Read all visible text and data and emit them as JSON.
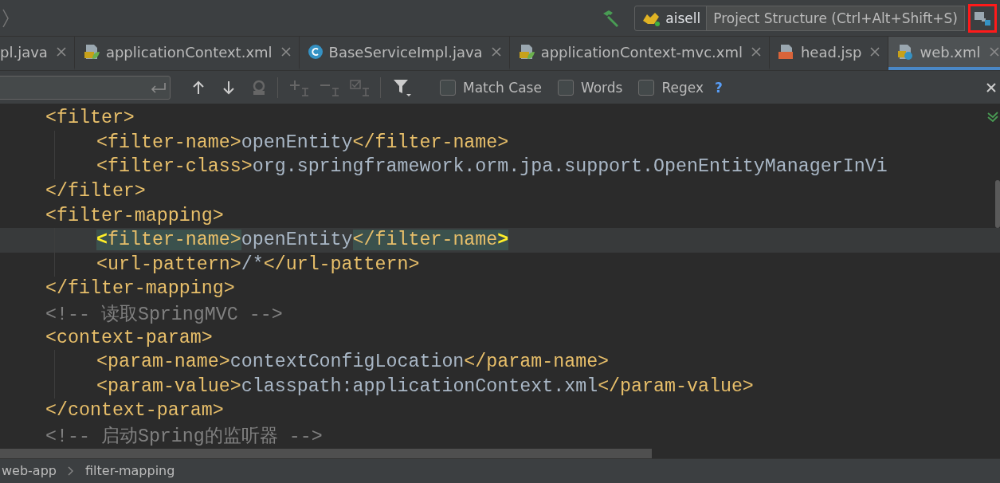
{
  "toolbar": {
    "run_config": "aisell",
    "tooltip": "Project Structure (Ctrl+Alt+Shift+S)"
  },
  "tabs": [
    {
      "label": "pl.java",
      "kind": "java",
      "selected": false
    },
    {
      "label": "applicationContext.xml",
      "kind": "spring",
      "selected": false
    },
    {
      "label": "BaseServiceImpl.java",
      "kind": "class",
      "selected": false
    },
    {
      "label": "applicationContext-mvc.xml",
      "kind": "spring",
      "selected": false
    },
    {
      "label": "head.jsp",
      "kind": "jsp",
      "selected": false
    },
    {
      "label": "web.xml",
      "kind": "web",
      "selected": true
    }
  ],
  "find_bar": {
    "options": [
      {
        "label": "Match Case",
        "checked": false
      },
      {
        "label": "Words",
        "checked": false
      },
      {
        "label": "Regex",
        "checked": false
      }
    ],
    "help": "?"
  },
  "code_lines": [
    {
      "indented": false,
      "current": false,
      "segments": [
        {
          "kind": "tag",
          "text": "<filter>"
        }
      ]
    },
    {
      "indented": true,
      "current": false,
      "segments": [
        {
          "kind": "tag",
          "text": "<filter-name>"
        },
        {
          "kind": "text",
          "text": "openEntity"
        },
        {
          "kind": "tag",
          "text": "</filter-name>"
        }
      ]
    },
    {
      "indented": true,
      "current": false,
      "segments": [
        {
          "kind": "tag",
          "text": "<filter-class>"
        },
        {
          "kind": "text",
          "text": "org.springframework.orm.jpa.support.OpenEntityManagerInVi"
        }
      ]
    },
    {
      "indented": false,
      "current": false,
      "segments": [
        {
          "kind": "tag",
          "text": "</filter>"
        }
      ]
    },
    {
      "indented": false,
      "current": false,
      "segments": [
        {
          "kind": "tag",
          "text": "<filter-mapping>"
        }
      ]
    },
    {
      "indented": true,
      "current": true,
      "segments": [
        {
          "kind": "brace",
          "text": "<"
        },
        {
          "kind": "match",
          "text": "filter-name>"
        },
        {
          "kind": "text",
          "text": "openEntity"
        },
        {
          "kind": "match",
          "text": "</filter-name"
        },
        {
          "kind": "brace",
          "text": ">"
        }
      ]
    },
    {
      "indented": true,
      "current": false,
      "segments": [
        {
          "kind": "tag",
          "text": "<url-pattern>"
        },
        {
          "kind": "text",
          "text": "/*"
        },
        {
          "kind": "tag",
          "text": "</url-pattern>"
        }
      ]
    },
    {
      "indented": false,
      "current": false,
      "segments": [
        {
          "kind": "tag",
          "text": "</filter-mapping>"
        }
      ]
    },
    {
      "indented": false,
      "current": false,
      "segments": [
        {
          "kind": "comment",
          "text": "<!-- 读取SpringMVC -->"
        }
      ]
    },
    {
      "indented": false,
      "current": false,
      "segments": [
        {
          "kind": "tag",
          "text": "<context-param>"
        }
      ]
    },
    {
      "indented": true,
      "current": false,
      "segments": [
        {
          "kind": "tag",
          "text": "<param-name>"
        },
        {
          "kind": "text",
          "text": "contextConfigLocation"
        },
        {
          "kind": "tag",
          "text": "</param-name>"
        }
      ]
    },
    {
      "indented": true,
      "current": false,
      "segments": [
        {
          "kind": "tag",
          "text": "<param-value>"
        },
        {
          "kind": "text",
          "text": "classpath:applicationContext.xml"
        },
        {
          "kind": "tag",
          "text": "</param-value>"
        }
      ]
    },
    {
      "indented": false,
      "current": false,
      "segments": [
        {
          "kind": "tag",
          "text": "</context-param>"
        }
      ]
    },
    {
      "indented": false,
      "current": false,
      "segments": [
        {
          "kind": "comment",
          "text": "<!-- 启动Spring的监听器 -->"
        }
      ]
    }
  ],
  "breadcrumbs": [
    "web-app",
    "filter-mapping"
  ]
}
